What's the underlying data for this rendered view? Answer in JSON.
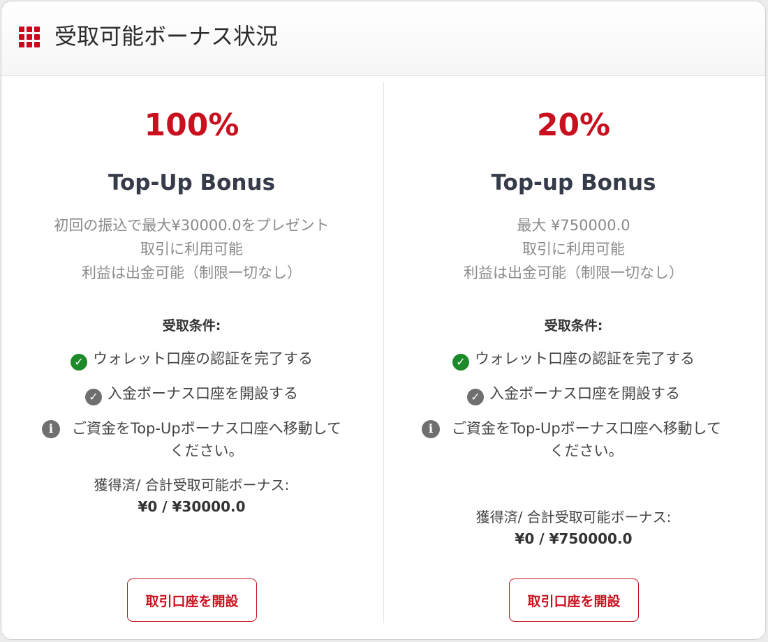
{
  "header": {
    "title": "受取可能ボーナス状況",
    "icon": "grid-icon",
    "accent_color": "#d0021b"
  },
  "cards": [
    {
      "percent": "100%",
      "title": "Top-Up Bonus",
      "description": [
        "初回の振込で最大¥30000.0をプレゼント",
        "取引に利用可能",
        "利益は出金可能（制限一切なし）"
      ],
      "conditions_title": "受取条件:",
      "conditions": [
        {
          "text": "ウォレット口座の認証を完了する",
          "icon": "check-circle-icon",
          "status": "complete"
        },
        {
          "text": "入金ボーナス口座を開設する",
          "icon": "check-circle-icon",
          "status": "incomplete"
        },
        {
          "text": "ご資金をTop-Upボーナス口座へ移動してください。",
          "icon": "info-icon",
          "status": "info"
        }
      ],
      "earned_label": "獲得済/ 合計受取可能ボーナス:",
      "earned_value": "¥0 / ¥30000.0",
      "button_label": "取引口座を開設"
    },
    {
      "percent": "20%",
      "title": "Top-up Bonus",
      "description": [
        "最大 ¥750000.0",
        "取引に利用可能",
        "利益は出金可能（制限一切なし）"
      ],
      "conditions_title": "受取条件:",
      "conditions": [
        {
          "text": "ウォレット口座の認証を完了する",
          "icon": "check-circle-icon",
          "status": "complete"
        },
        {
          "text": "入金ボーナス口座を開設する",
          "icon": "check-circle-icon",
          "status": "incomplete"
        },
        {
          "text": "ご資金をTop-Upボーナス口座へ移動してください。",
          "icon": "info-icon",
          "status": "info"
        }
      ],
      "earned_label": "獲得済/ 合計受取可能ボーナス:",
      "earned_value": "¥0 / ¥750000.0",
      "button_label": "取引口座を開設"
    }
  ],
  "colors": {
    "accent": "#c8101e",
    "check_complete": "#1d8a2a",
    "check_incomplete": "#6f6f6f",
    "title_text": "#353b48"
  }
}
